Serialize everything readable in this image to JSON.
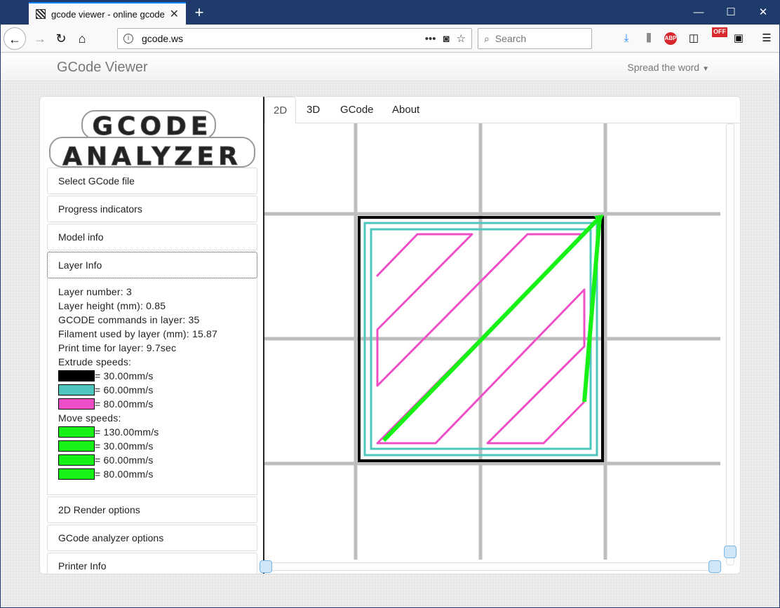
{
  "browser": {
    "tab_title": "gcode viewer - online gcode viewer",
    "new_tab_label": "+",
    "url": "gcode.ws",
    "search_placeholder": "Search",
    "page_actions_label": "•••",
    "offbadge": "OFF",
    "abp": "ABP"
  },
  "site": {
    "brand": "GCode Viewer",
    "spread_label": "Spread the word"
  },
  "logo": {
    "line1": "GCODE",
    "line2": "ANALYZER"
  },
  "sidebar": {
    "sections_top": [
      {
        "label": "Select GCode file"
      },
      {
        "label": "Progress indicators"
      },
      {
        "label": "Model info"
      },
      {
        "label": "Layer Info"
      }
    ],
    "sections_bottom": [
      {
        "label": "2D Render options"
      },
      {
        "label": "GCode analyzer options"
      },
      {
        "label": "Printer Info"
      }
    ]
  },
  "layer_info": {
    "layer_number": "Layer number: 3",
    "layer_height": "Layer height (mm): 0.85",
    "commands": "GCODE commands in layer: 35",
    "filament": "Filament used by layer (mm): 15.87",
    "print_time": "Print time for layer: 9.7sec",
    "extrude_title": "Extrude speeds:",
    "extrude_speeds": [
      {
        "color": "#000000",
        "label": "= 30.00mm/s"
      },
      {
        "color": "#4ec5bd",
        "label": "= 60.00mm/s"
      },
      {
        "color": "#ef4fc6",
        "label": "= 80.00mm/s"
      }
    ],
    "move_title": "Move speeds:",
    "move_speeds": [
      {
        "color": "#16f216",
        "label": "= 130.00mm/s"
      },
      {
        "color": "#16f216",
        "label": "= 30.00mm/s"
      },
      {
        "color": "#16f216",
        "label": "= 60.00mm/s"
      },
      {
        "color": "#16f216",
        "label": "= 80.00mm/s"
      }
    ]
  },
  "main_tabs": [
    {
      "label": "2D"
    },
    {
      "label": "3D"
    },
    {
      "label": "GCode"
    },
    {
      "label": "About"
    }
  ],
  "colors": {
    "grid": "#bdbdbd",
    "outline": "#000000",
    "perimeter": "#4ec5bd",
    "infill": "#ef4fc6",
    "travel": "#16f216"
  },
  "icons": [
    "back-icon",
    "forward-icon",
    "reload-icon",
    "home-icon",
    "info-icon",
    "pocket-icon",
    "bookmark-star-icon",
    "search-icon",
    "download-icon",
    "library-icon",
    "sidebar-icon",
    "menu-icon"
  ]
}
